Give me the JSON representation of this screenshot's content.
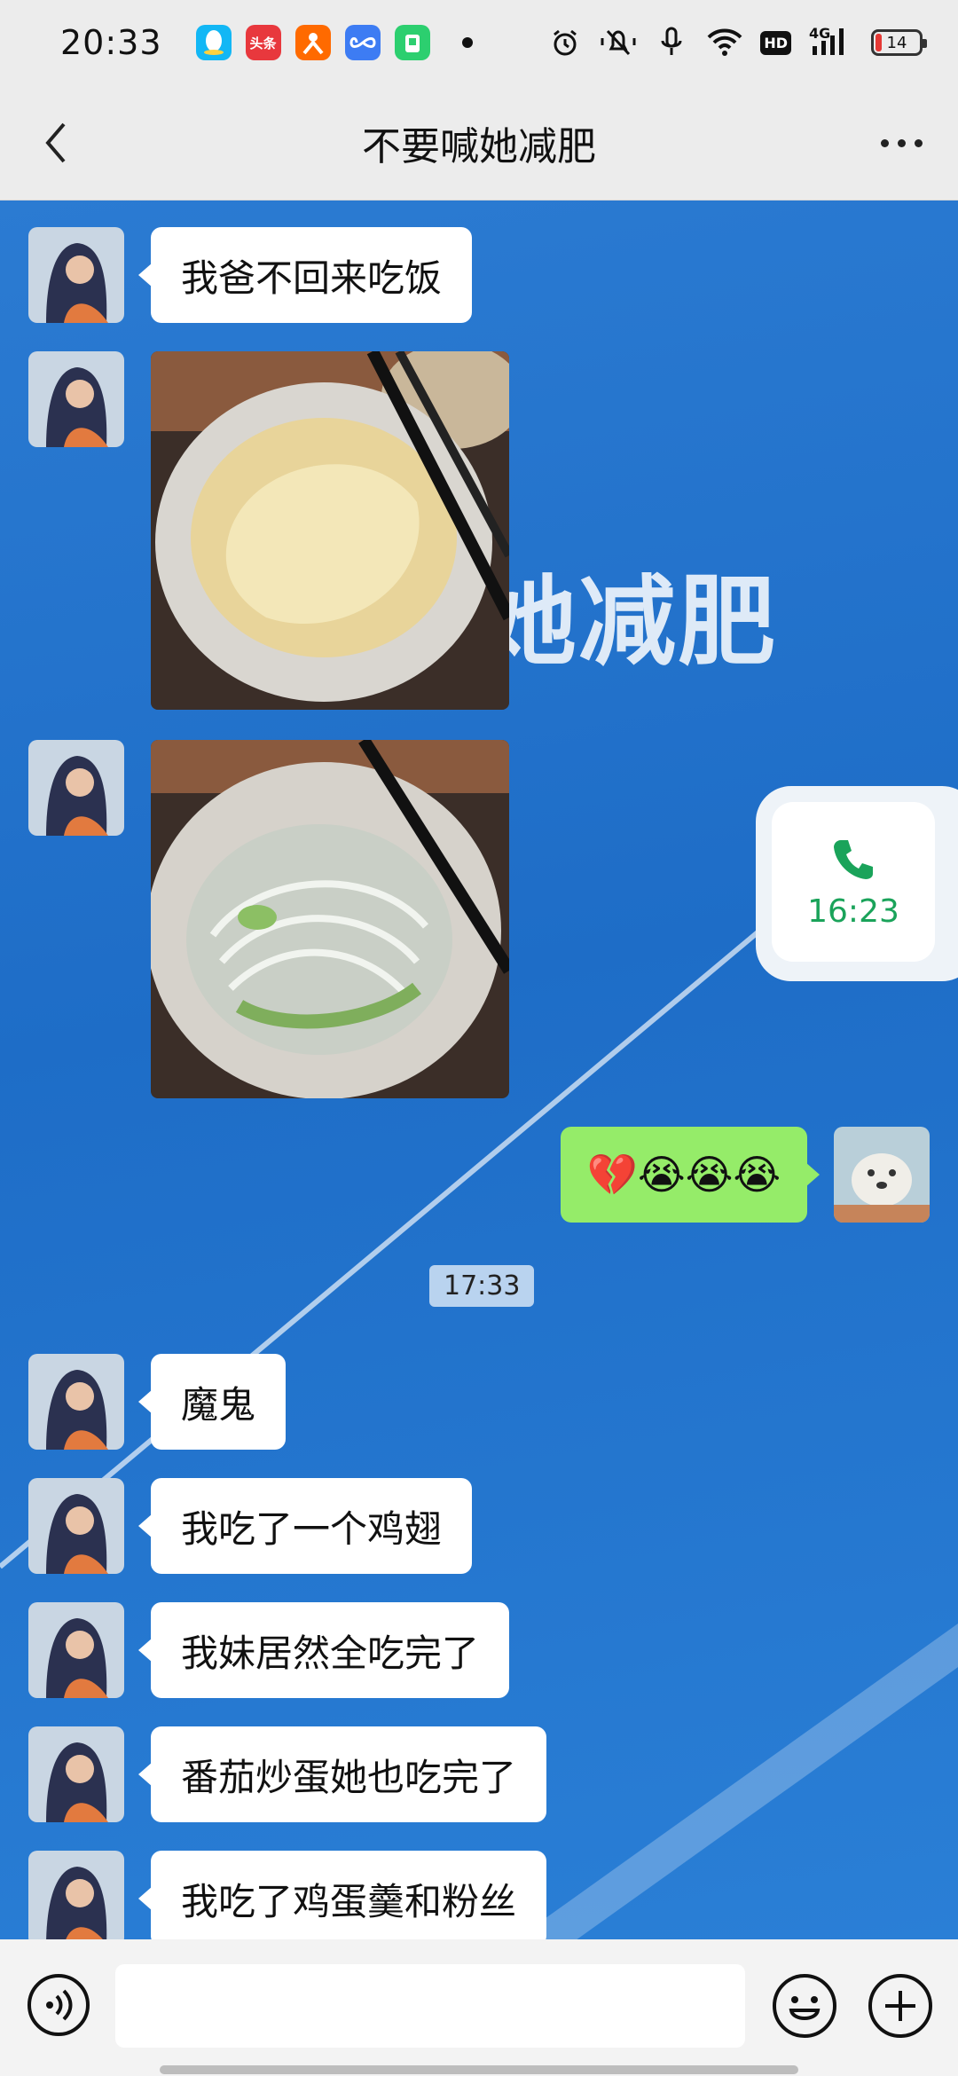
{
  "status_bar": {
    "time": "20:33",
    "app_icons": [
      {
        "icon": "qq-icon",
        "color": "#12b7f5",
        "text": ""
      },
      {
        "icon": "toutiao-icon",
        "color": "#e8383d",
        "text": "头条"
      },
      {
        "icon": "taobao-icon",
        "color": "#ff6a00",
        "text": ""
      },
      {
        "icon": "infinity-app-icon",
        "color": "#3d7cf3",
        "text": ""
      },
      {
        "icon": "green-app-icon",
        "color": "#2ccf6f",
        "text": ""
      }
    ],
    "hd": "HD",
    "network": "4G",
    "battery": "14"
  },
  "header": {
    "title": "不要喊她减肥"
  },
  "background": {
    "text": "她减肥"
  },
  "messages": {
    "m1": "我爸不回来吃饭",
    "emoji_reply": "💔😭😭😭",
    "call_time": "16:23",
    "time_divider": "17:33",
    "m2": "魔鬼",
    "m3": "我吃了一个鸡翅",
    "m4": "我妹居然全吃完了",
    "m5": "番茄炒蛋她也吃完了",
    "m6": "我吃了鸡蛋羹和粉丝"
  },
  "colors": {
    "accent_green": "#95ec69",
    "call_green": "#1aa35a"
  }
}
